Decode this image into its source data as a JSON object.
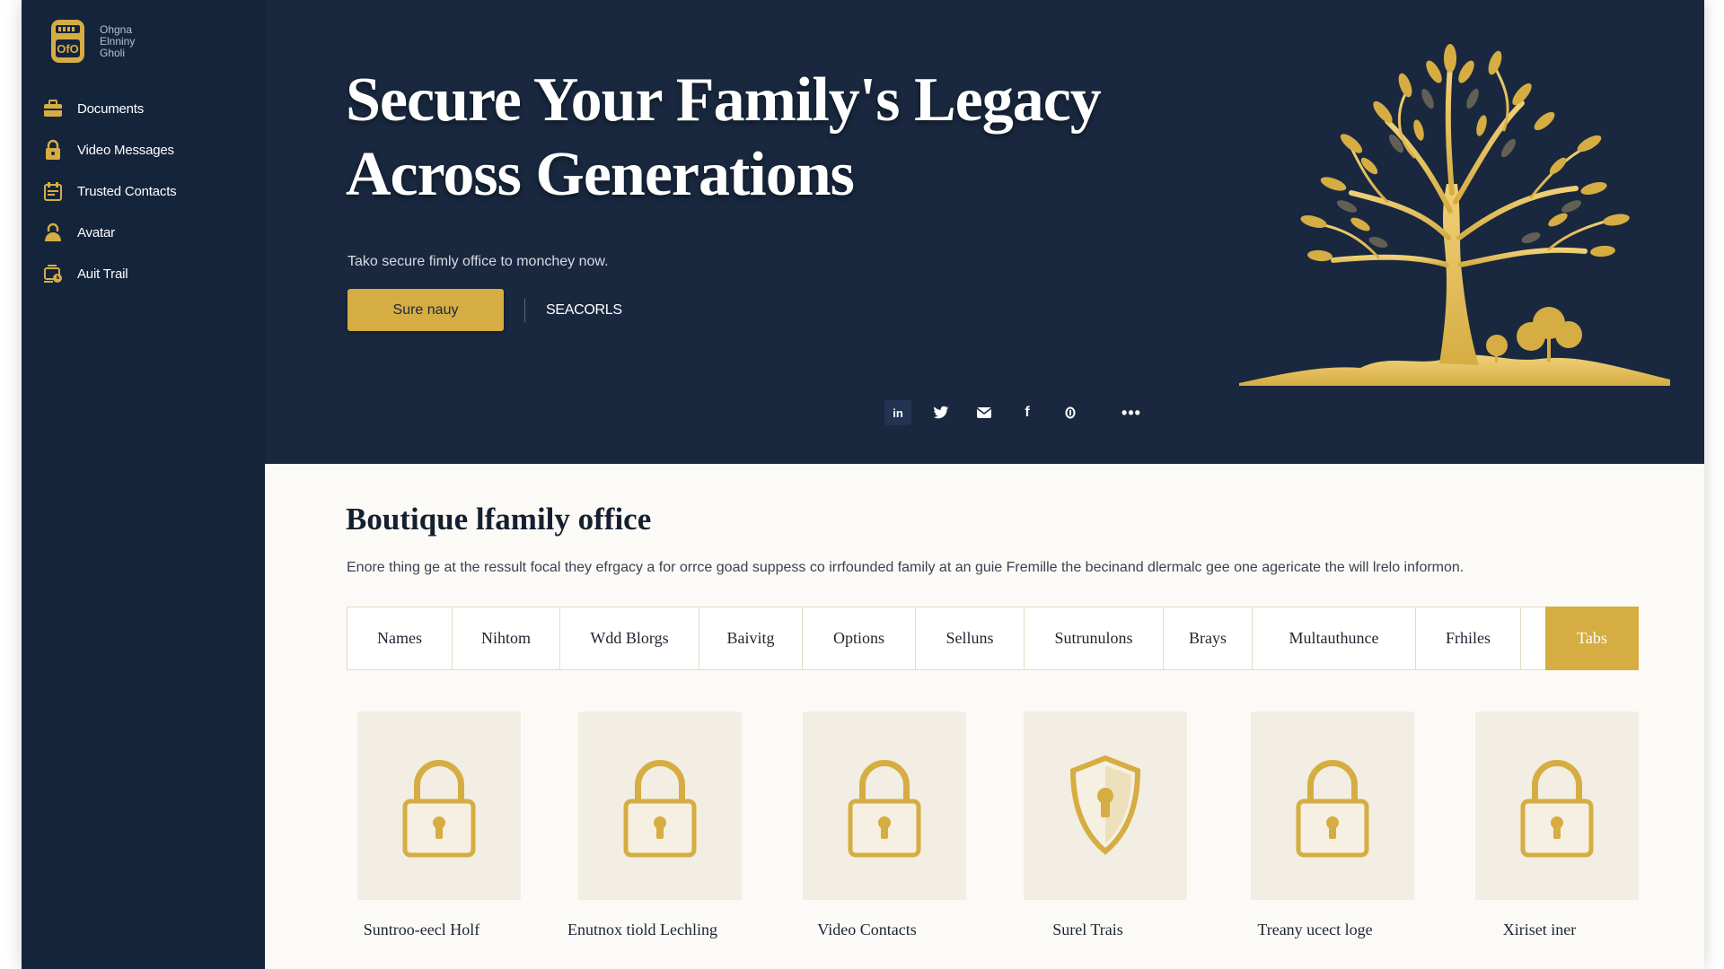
{
  "brand": {
    "logo_lines": [
      "Ohgna",
      "Elnniny",
      "Gholi"
    ],
    "accent": "#d6ad43",
    "navy": "#14243b"
  },
  "sidebar": {
    "items": [
      {
        "label": "Documents",
        "icon": "briefcase-icon"
      },
      {
        "label": "Video Messages",
        "icon": "padlock-icon"
      },
      {
        "label": "Trusted Contacts",
        "icon": "contacts-icon"
      },
      {
        "label": "Avatar",
        "icon": "user-icon"
      },
      {
        "label": "Auit Trail",
        "icon": "audit-icon"
      }
    ]
  },
  "hero": {
    "title_line1": "Secure Your Family's Legacy",
    "title_line2": "Across Generations",
    "subtitle": "Tako secure fimly office to monchey now.",
    "primary_button": "Sure nauy",
    "secondary_button": "SEACORLS",
    "social": [
      {
        "glyph": "in",
        "icon": "linkedin-icon"
      },
      {
        "glyph": "🐦",
        "icon": "twitter-icon"
      },
      {
        "glyph": "✉",
        "icon": "mail-icon"
      },
      {
        "glyph": "f",
        "icon": "facebook-icon"
      },
      {
        "glyph": "◐",
        "icon": "circle-icon"
      },
      {
        "glyph": "•••",
        "icon": "more-icon"
      }
    ]
  },
  "section": {
    "title": "Boutique lfamily office",
    "description": "Enore thing ge at the ressult focal they efrgacy a for orrce goad suppess co irrfounded family at an guie Fremille the becinand dlermalc gee one agericate the will lrelo informon."
  },
  "tabs": [
    "Names",
    "Nihtom",
    "Wdd Blorgs",
    "Baivitg",
    "Options",
    "Selluns",
    "Sutrunulons",
    "Brays",
    "Multauthunce",
    "Frhiles",
    "Tabs"
  ],
  "active_tab": "Tabs",
  "cards": [
    {
      "label": "Suntroo-eecl Holf",
      "icon": "padlock-icon"
    },
    {
      "label": "Enutnox tiold Lechling",
      "icon": "padlock-icon"
    },
    {
      "label": "Video Contacts",
      "icon": "padlock-icon"
    },
    {
      "label": "Surel Trais",
      "icon": "shield-lock-icon"
    },
    {
      "label": "Treany ucect loge",
      "icon": "padlock-icon"
    },
    {
      "label": "Xiriset iner",
      "icon": "padlock-icon"
    }
  ]
}
